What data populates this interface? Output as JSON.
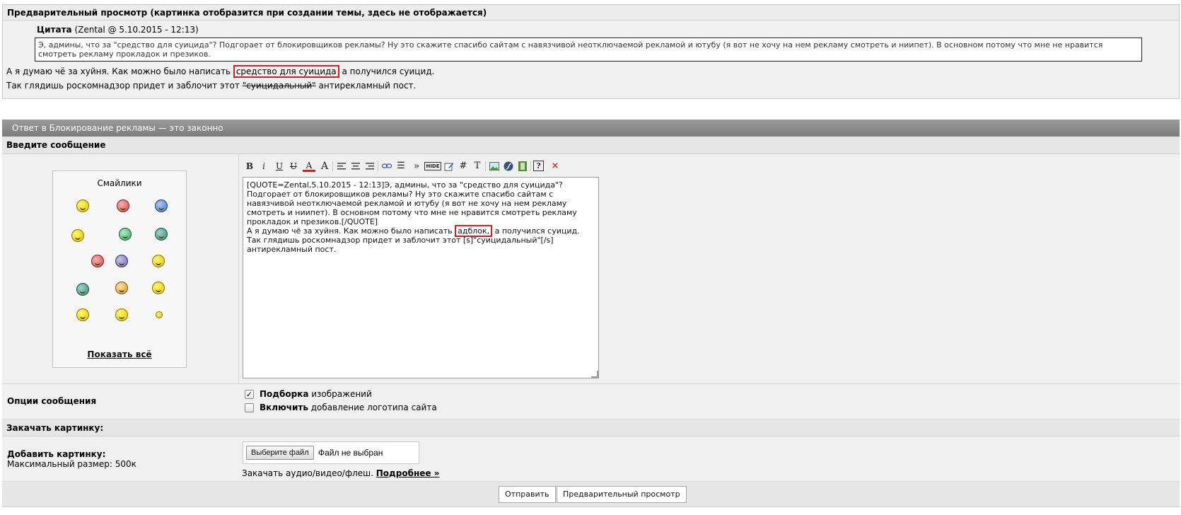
{
  "preview": {
    "header": "Предварительный просмотр (картинка отобразится при создании темы, здесь не отображается)",
    "quote_label": "Цитата",
    "quote_meta": "(Zental @ 5.10.2015 - 12:13)",
    "quote_text": "Э, админы, что за \"средство для суицида\"? Подгорает от блокировщиков рекламы? Ну это скажите спасибо сайтам с навязчивой неотключаемой рекламой и ютубу (я вот не хочу на нем рекламу смотреть и ниипет). В основном потому что мне не нравится смотреть рекламу прокладок и презиков.",
    "line1_before": "А я думаю чё за хуйня. Как можно было написать ",
    "line1_highlight": "средство для суицида",
    "line1_after": " а получился суицид.",
    "line2_before": "Так глядишь роскомнадзор придет и заблочит этот ",
    "line2_strike": "\"суицидальный\"",
    "line2_after": " антирекламный пост."
  },
  "reply": {
    "title": "Ответ в Блокирование рекламы — это законно",
    "enter_message": "Введите сообщение"
  },
  "smilies": {
    "title": "Смайлики",
    "show_all": "Показать всё",
    "icons": [
      "cool-smiley-icon",
      "love-smiley-icon",
      "cold-smiley-icon",
      "thinking-smiley-icon",
      "alien-smiley-icon",
      "eyes-smiley-icon",
      "dart-smiley-icon",
      "ghost-smiley-icon",
      "bat-smiley-icon",
      "sick-smiley-icon",
      "clap-smiley-icon",
      "dance-smiley-icon",
      "idea-smiley-icon",
      "laugh-smiley-icon",
      "star-smiley-icon"
    ]
  },
  "toolbar": {
    "bold": "B",
    "italic": "i",
    "underline": "U",
    "strike": "U",
    "color": "A",
    "size": "A",
    "list": "☰",
    "more": "»",
    "hide": "HIDE",
    "hash": "#",
    "text": "T",
    "help": "?",
    "remove": "×"
  },
  "editor": {
    "text_before": "[QUOTE=Zental,5.10.2015 - 12:13]Э, админы, что за \"средство для суицида\"? Подгорает от блокировщиков рекламы? Ну это скажите спасибо сайтам с навязчивой неотключаемой рекламой и ютубу (я вот не хочу на нем рекламу смотреть и ниипет). В основном потому что мне не нравится смотреть рекламу прокладок и презиков.[/QUOTE]\nА я думаю чё за хуйня. Как можно было написать ",
    "highlight": "адблок,",
    "text_after": " а получился суицид.\nТак глядишь роскомнадзор придет и заблочит этот [s]\"суицидальный\"[/s] антирекламный пост."
  },
  "options": {
    "label": "Опции сообщения",
    "opt1_bold": "Подборка",
    "opt1_rest": " изображений",
    "opt1_checked": true,
    "opt2_bold": "Включить",
    "opt2_rest": " добавление логотипа сайта",
    "opt2_checked": false
  },
  "upload": {
    "header": "Закачать картинку:",
    "label": "Добавить картинку:",
    "max_size": "Максимальный размер: 500к",
    "file_button": "Выберите файл",
    "file_status": "Файл не выбран",
    "media_text": "Закачать аудио/видео/флеш. ",
    "media_link": "Подробнее »"
  },
  "buttons": {
    "submit": "Отправить",
    "preview": "Предварительный просмотр"
  },
  "colors": {
    "highlight_border": "#d21f1f",
    "header_bar": "#8a8a8a"
  }
}
